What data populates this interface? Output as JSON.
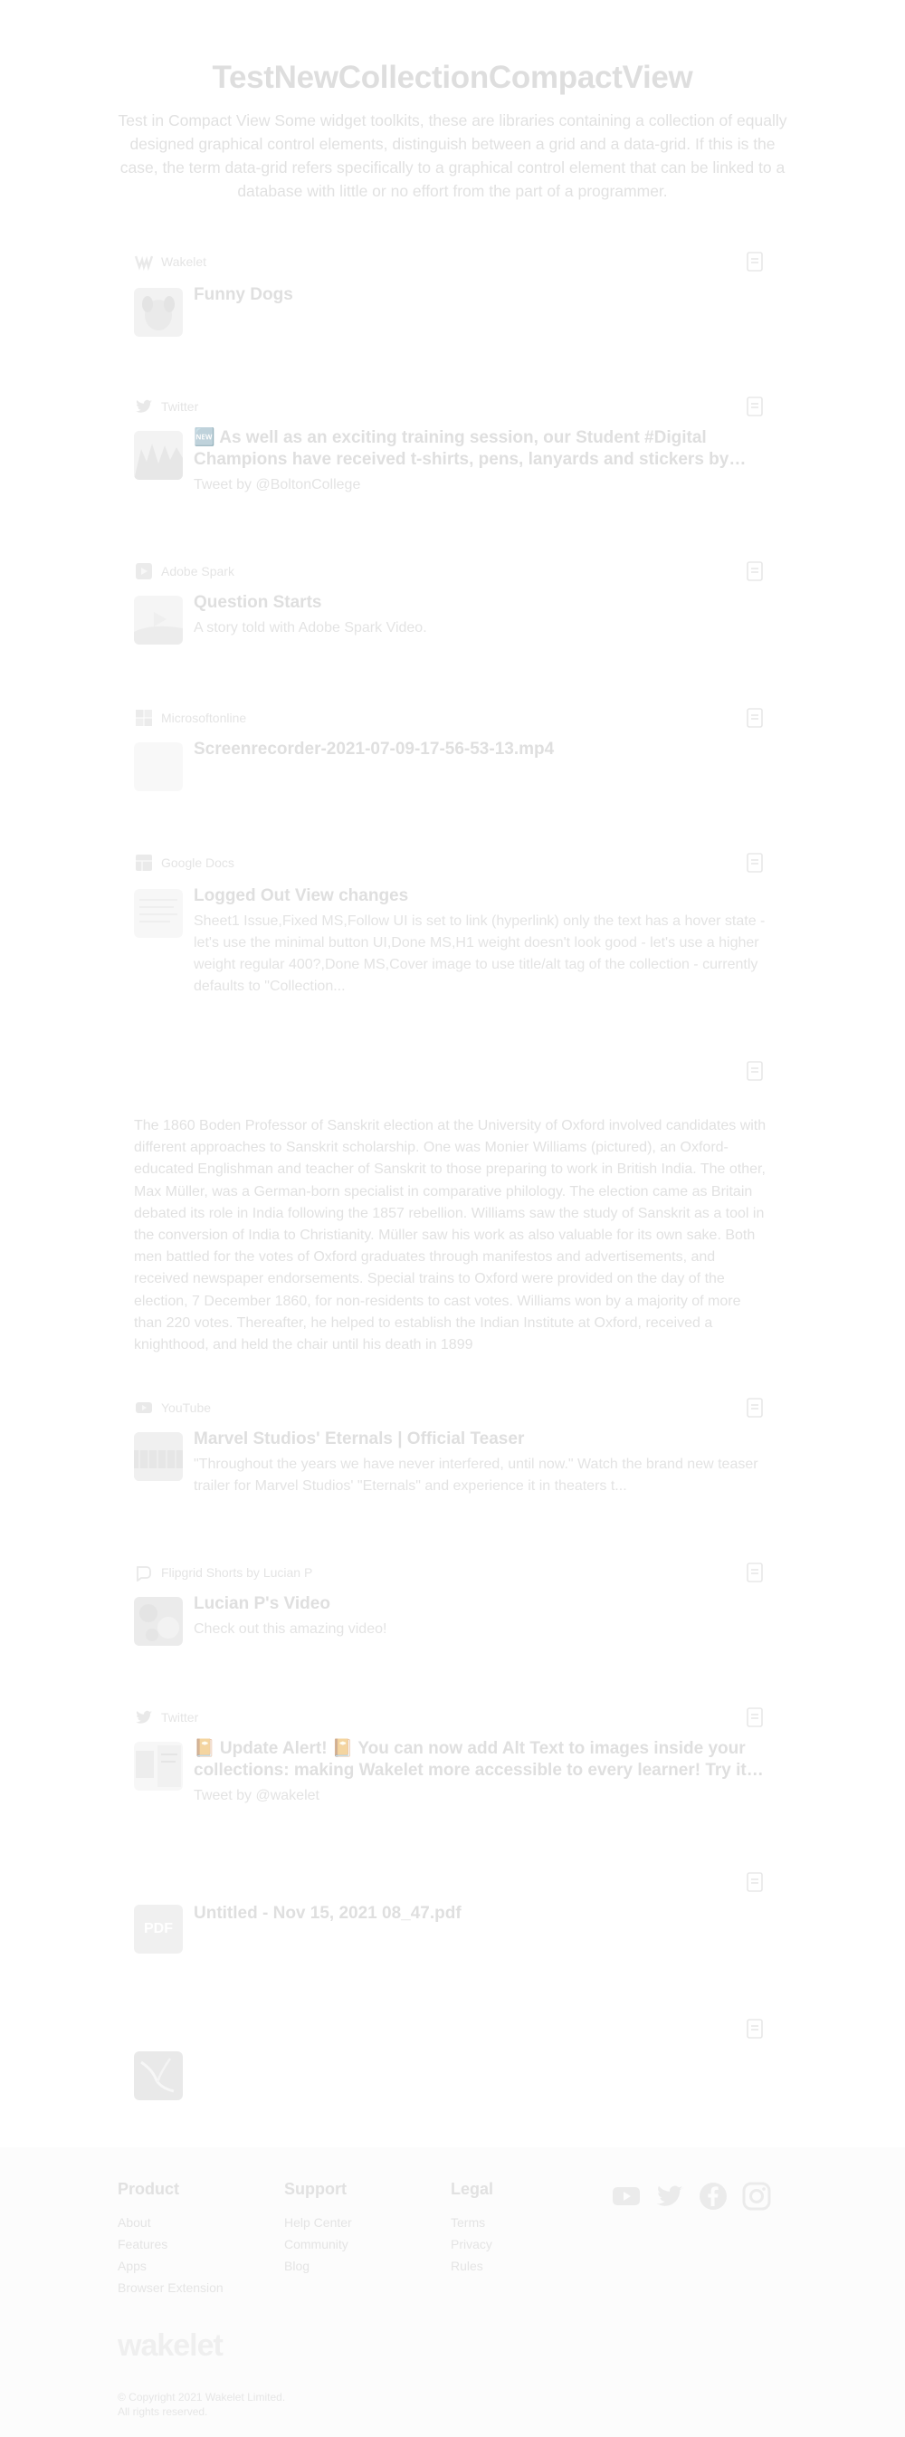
{
  "header": {
    "title": "TestNewCollectionCompactView",
    "description": "Test in Compact View Some widget toolkits, these are libraries containing a collection of equally designed graphical control elements, distinguish between a grid and a data-grid. If this is the case, the term data-grid refers specifically to a graphical control element that can be linked to a database with little or no effort from the part of a programmer."
  },
  "items": [
    {
      "source": "Wakelet",
      "source_icon": "wakelet-icon",
      "title": "Funny Dogs",
      "text": ""
    },
    {
      "source": "Twitter",
      "source_icon": "twitter-icon",
      "title": "🆕 As well as an exciting training session, our Student #Digital Champions have received t-shirts, pens, lanyards and stickers by innovative #internet...",
      "text": "Tweet by @BoltonCollege"
    },
    {
      "source": "Adobe Spark",
      "source_icon": "adobe-spark-icon",
      "title": "Question Starts",
      "text": "A story told with Adobe Spark Video."
    },
    {
      "source": "Microsoftonline",
      "source_icon": "microsoft-icon",
      "title": "Screenrecorder-2021-07-09-17-56-53-13.mp4",
      "text": ""
    },
    {
      "source": "Google Docs",
      "source_icon": "google-docs-icon",
      "title": "Logged Out View changes",
      "text": "Sheet1 Issue,Fixed MS,Follow UI is set to link (hyperlink) only the text has a hover state - let's use the minimal button UI,Done MS,H1 weight doesn't look good - let's use a higher weight regular 400?,Done MS,Cover image to use title/alt tag of the collection - currently defaults to \"Collection..."
    },
    {
      "note": "The 1860 Boden Professor of Sanskrit election at the University of Oxford involved candidates with different approaches to Sanskrit scholarship. One was Monier Williams (pictured), an Oxford-educated Englishman and teacher of Sanskrit to those preparing to work in British India. The other, Max Müller, was a German-born specialist in comparative philology. The election came as Britain debated its role in India following the 1857 rebellion. Williams saw the study of Sanskrit as a tool in the conversion of India to Christianity. Müller saw his work as also valuable for its own sake. Both men battled for the votes of Oxford graduates through manifestos and advertisements, and received newspaper endorsements. Special trains to Oxford were provided on the day of the election, 7 December 1860, for non-residents to cast votes. Williams won by a majority of more than 220 votes. Thereafter, he helped to establish the Indian Institute at Oxford, received a knighthood, and held the chair until his death in 1899"
    },
    {
      "source": "YouTube",
      "source_icon": "youtube-icon",
      "title": "Marvel Studios' Eternals | Official Teaser",
      "text": "\"Throughout the years we have never interfered, until now.\" Watch the brand new teaser trailer for Marvel Studios' \"Eternals\" and experience it in theaters t..."
    },
    {
      "source": "Flipgrid Shorts by Lucian P",
      "source_icon": "flipgrid-icon",
      "title": "Lucian P's Video",
      "text": "Check out this amazing video!"
    },
    {
      "source": "Twitter",
      "source_icon": "twitter-icon",
      "title": "📔 Update Alert! 📔 You can now add Alt Text to images inside your collections: making Wakelet more accessible to every learner! Try it now a...",
      "text": "Tweet by @wakelet"
    },
    {
      "title": "Untitled - Nov 15, 2021 08_47.pdf",
      "thumb_label": "PDF"
    },
    {
      "image": "image-thumbnail"
    }
  ],
  "footer": {
    "product": {
      "heading": "Product",
      "links": [
        "About",
        "Features",
        "Apps",
        "Browser Extension"
      ]
    },
    "support": {
      "heading": "Support",
      "links": [
        "Help Center",
        "Community",
        "Blog"
      ]
    },
    "legal": {
      "heading": "Legal",
      "links": [
        "Terms",
        "Privacy",
        "Rules"
      ]
    },
    "social": [
      "youtube-icon",
      "twitter-icon",
      "facebook-icon",
      "instagram-icon"
    ],
    "logo": "wakelet",
    "copyright": [
      "© Copyright 2021 Wakelet Limited.",
      "All rights reserved."
    ]
  }
}
